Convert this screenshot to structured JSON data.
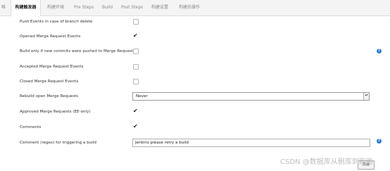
{
  "tabs": [
    {
      "label": "唯"
    },
    {
      "label": "构建触发器"
    },
    {
      "label": "构建环境"
    },
    {
      "label": "Pre Steps"
    },
    {
      "label": "Build"
    },
    {
      "label": "Post Steps"
    },
    {
      "label": "构建设置"
    },
    {
      "label": "构建后操作"
    }
  ],
  "form": {
    "rows": [
      {
        "label": "Push Events in case of branch delete",
        "checked": false
      },
      {
        "label": "Opened Merge Request Events",
        "checked": true
      },
      {
        "label": "Build only if new commits were pushed to Merge Request",
        "checked": false
      },
      {
        "label": "Accepted Merge Request Events",
        "checked": false
      },
      {
        "label": "Closed Merge Request Events",
        "checked": false
      },
      {
        "label": "Rebuild open Merge Requests"
      },
      {
        "label": "Approved Merge Requests (EE-only)",
        "checked": true
      },
      {
        "label": "Comments",
        "checked": true
      },
      {
        "label": "Comment (regex) for triggering a build"
      }
    ],
    "rebuild_select": {
      "value": "Never"
    },
    "comment_regex": {
      "value": "Jenkins please retry a build"
    },
    "help_glyph": "?",
    "check_glyph": "✔",
    "select_arrow_glyphs": "▴▾",
    "advanced_label": "高级"
  },
  "watermark": "CSDN @数据库从删库到跑路",
  "colors": {
    "help": "#2f7fcf",
    "tab_bar": "#f4f4f4"
  }
}
